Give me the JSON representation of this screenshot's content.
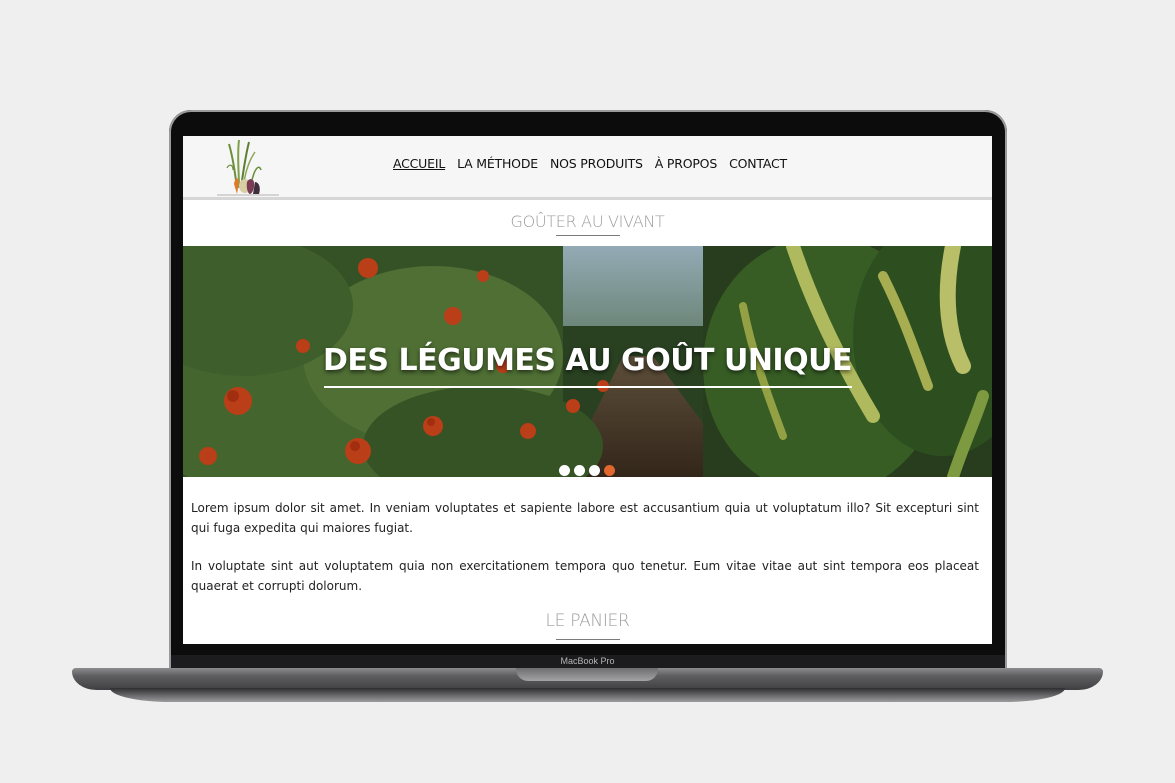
{
  "device": {
    "model_label": "MacBook Pro"
  },
  "nav": {
    "items": [
      {
        "label": "ACCUEIL",
        "active": true
      },
      {
        "label": "LA MÉTHODE"
      },
      {
        "label": "NOS PRODUITS"
      },
      {
        "label": "À PROPOS"
      },
      {
        "label": "CONTACT"
      }
    ]
  },
  "sections": {
    "first_title": "GOÛTER AU VIVANT",
    "second_title": "LE PANIER"
  },
  "hero": {
    "title": "DES LÉGUMES AU GOÛT UNIQUE",
    "slides": 4,
    "active_slide": 4
  },
  "paragraphs": [
    "Lorem ipsum dolor sit amet. In veniam voluptates et sapiente labore est accusantium quia ut voluptatum illo? Sit excepturi sint qui fuga expedita qui maiores fugiat.",
    "In voluptate sint aut voluptatem quia non exercitationem tempora quo tenetur. Eum vitae vitae aut sint tempora eos placeat quaerat et corrupti dolorum."
  ],
  "colors": {
    "accent": "#e0672d",
    "page_bg": "#efefef",
    "header_bg": "#f6f6f6",
    "section_title": "#9c9c9c"
  },
  "icons": [
    "vegetables-logo-icon"
  ]
}
